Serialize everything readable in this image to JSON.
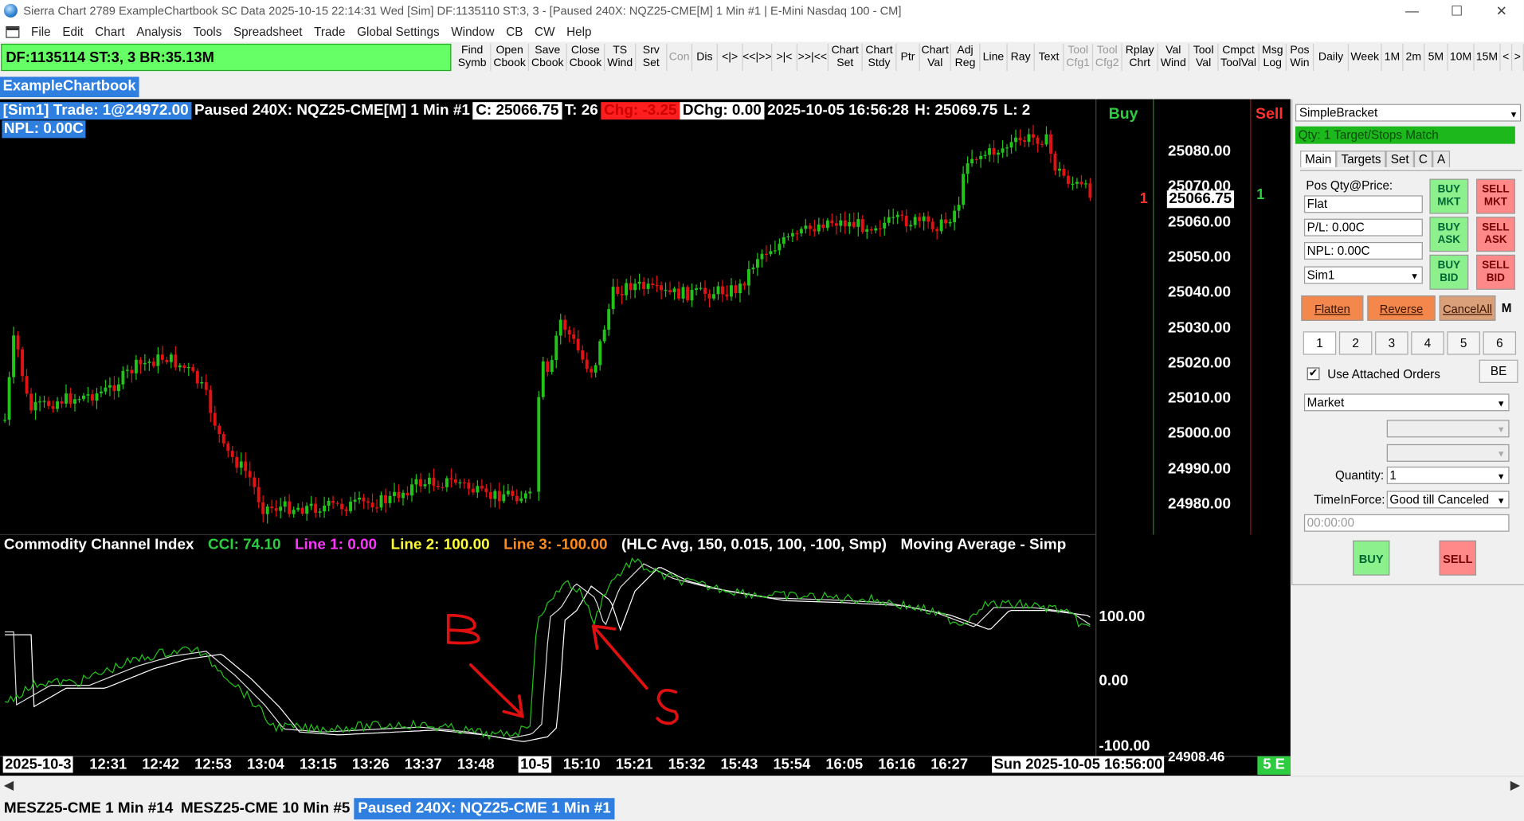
{
  "window": {
    "title": "Sierra Chart 2789 ExampleChartbook SC Data 2025-10-15  22:14:31 Wed [Sim] DF:1135110  ST:3, 3 - [Paused 240X: NQZ25-CME[M]  1 Min  #1 | E-Mini Nasdaq 100 - CM]",
    "minimize": "—",
    "maximize": "☐",
    "close": "✕"
  },
  "menu": [
    "File",
    "Edit",
    "Chart",
    "Analysis",
    "Tools",
    "Spreadsheet",
    "Trade",
    "Global Settings",
    "Window",
    "CB",
    "CW",
    "Help"
  ],
  "status": "DF:1135114  ST:3, 3  BR:35.13M",
  "toolbar": [
    {
      "label": "Find\nSymb",
      "dim": false
    },
    {
      "label": "Open\nCbook",
      "dim": false
    },
    {
      "label": "Save\nCbook",
      "dim": false
    },
    {
      "label": "Close\nCbook",
      "dim": false
    },
    {
      "label": "TS\nWind",
      "dim": false
    },
    {
      "label": "Srv\nSet",
      "dim": false
    },
    {
      "label": "Con",
      "dim": true
    },
    {
      "label": "Dis",
      "dim": false
    },
    {
      "label": "<|>",
      "dim": false
    },
    {
      "label": "<<|>>",
      "dim": false
    },
    {
      "label": ">|<",
      "dim": false
    },
    {
      "label": ">>|<<",
      "dim": false
    },
    {
      "label": "Chart\nSet",
      "dim": false
    },
    {
      "label": "Chart\nStdy",
      "dim": false
    },
    {
      "label": "Ptr",
      "dim": false
    },
    {
      "label": "Chart\nVal",
      "dim": false
    },
    {
      "label": "Adj\nReg",
      "dim": false
    },
    {
      "label": "Line",
      "dim": false
    },
    {
      "label": "Ray",
      "dim": false
    },
    {
      "label": "Text",
      "dim": false
    },
    {
      "label": "Tool\nCfg1",
      "dim": true
    },
    {
      "label": "Tool\nCfg2",
      "dim": true
    },
    {
      "label": "Rplay\nChrt",
      "dim": false
    },
    {
      "label": "Val\nWind",
      "dim": false
    },
    {
      "label": "Tool\nVal",
      "dim": false
    },
    {
      "label": "Cmpct\nToolVal",
      "dim": false
    },
    {
      "label": "Msg\nLog",
      "dim": false
    },
    {
      "label": "Pos\nWin",
      "dim": false
    },
    {
      "label": "Daily",
      "dim": false
    },
    {
      "label": "Week",
      "dim": false
    },
    {
      "label": "1M",
      "dim": false
    },
    {
      "label": "2m",
      "dim": false
    },
    {
      "label": "5M",
      "dim": false
    },
    {
      "label": "10M",
      "dim": false
    },
    {
      "label": "15M",
      "dim": false
    },
    {
      "label": "<",
      "dim": false
    },
    {
      "label": ">",
      "dim": false
    }
  ],
  "chartbook_tab": "ExampleChartbook",
  "chart_header": {
    "sim": "[Sim1]  Trade: 1@24972.00",
    "symbol": "Paused 240X: NQZ25-CME[M]  1 Min  #1",
    "close": "C: 25066.75",
    "trades": "T: 26",
    "chg": "Chg: -3.25",
    "dchg": "DChg: 0.00",
    "datetime": "2025-10-05 16:56:28",
    "high": "H: 25069.75",
    "low": "L: 2",
    "npl": "NPL: 0.00C"
  },
  "labels": {
    "buy": "Buy",
    "sell": "Sell",
    "pos_red": "1",
    "pos_green": "1",
    "cur_price": "25066.75"
  },
  "price_axis": [
    "25080.00",
    "25070.00",
    "25060.00",
    "25050.00",
    "25040.00",
    "25030.00",
    "25020.00",
    "25010.00",
    "25000.00",
    "24990.00",
    "24980.00"
  ],
  "cci_header": {
    "name": "Commodity Channel Index",
    "cci": "CCI: 74.10",
    "line1": "Line 1: 0.00",
    "line2": "Line 2: 100.00",
    "line3": "Line 3: -100.00",
    "params": "(HLC Avg, 150, 0.015, 100, -100, Smp)",
    "ma": "Moving Average - Simp"
  },
  "cci_axis": [
    "100.00",
    "0.00",
    "-100.00"
  ],
  "cci_bottom_value": "24908.46",
  "time_axis": [
    "2025-10-3",
    "12:31",
    "12:42",
    "12:53",
    "13:04",
    "13:15",
    "13:26",
    "13:37",
    "13:48",
    "10-5",
    "15:10",
    "15:21",
    "15:32",
    "15:43",
    "15:54",
    "16:05",
    "16:16",
    "16:27",
    "Sun 2025-10-05  16:56:00"
  ],
  "annotations": {
    "b": "B",
    "s": "S"
  },
  "bottom_tabs": [
    {
      "label": "MESZ25-CME  1 Min  #14",
      "active": false
    },
    {
      "label": "MESZ25-CME  10 Min  #5",
      "active": false
    },
    {
      "label": "Paused 240X: NQZ25-CME  1 Min  #1",
      "active": true
    }
  ],
  "fivee": "5 E",
  "trade_window": {
    "strategy": "SimpleBracket",
    "qty_bar": "Qty: 1 Target/Stops Match",
    "tabs": [
      "Main",
      "Targets",
      "Set",
      "C",
      "A"
    ],
    "pos_label": "Pos Qty@Price:",
    "pos_value": "Flat",
    "pl": "P/L: 0.00C",
    "npl": "NPL: 0.00C",
    "account": "Sim1",
    "buy_mkt": "BUY MKT",
    "sell_mkt": "SELL MKT",
    "buy_ask": "BUY ASK",
    "sell_ask": "SELL ASK",
    "buy_bid": "BUY BID",
    "sell_bid": "SELL BID",
    "flatten": "Flatten",
    "reverse": "Reverse",
    "cancel_all": "CancelAll",
    "m": "M",
    "nums": [
      "1",
      "2",
      "3",
      "4",
      "5",
      "6"
    ],
    "use_attached": "Use Attached Orders",
    "be": "BE",
    "order_type": "Market",
    "quantity_label": "Quantity:",
    "quantity": "1",
    "tif_label": "TimeInForce:",
    "tif": "Good till Canceled",
    "time": "00:00:00",
    "buy": "BUY",
    "sell": "SELL"
  },
  "colors": {
    "bull": "#22c41a",
    "bear": "#e01212",
    "accent": "#2e7fe0",
    "status_green": "#66ff66"
  }
}
